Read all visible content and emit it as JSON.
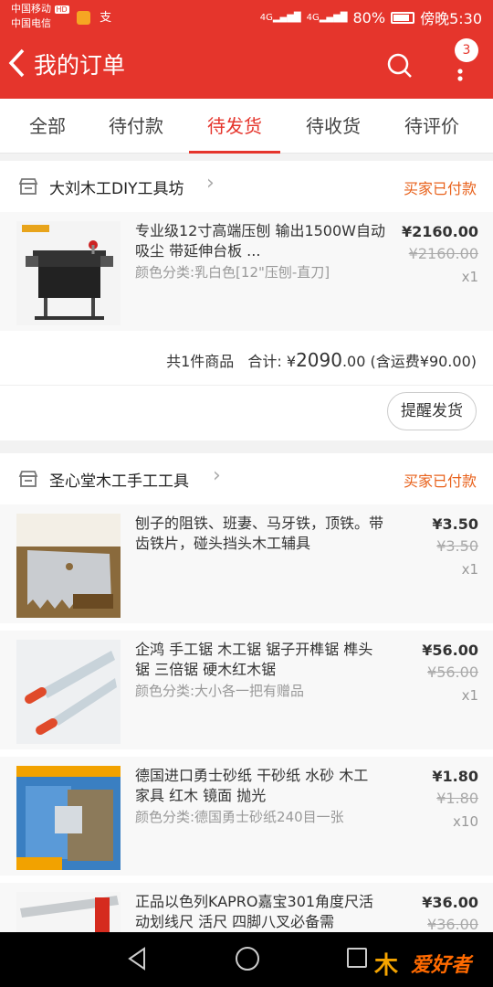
{
  "status_bar": {
    "carrier1": "中国移动",
    "carrier2": "中国电信",
    "hd": "HD",
    "net1": "4G",
    "net2": "4G",
    "battery": "80%",
    "time": "傍晚5:30"
  },
  "header": {
    "title": "我的订单",
    "badge": "3"
  },
  "tabs": [
    "全部",
    "待付款",
    "待发货",
    "待收货",
    "待评价"
  ],
  "active_tab": "待发货",
  "orders": [
    {
      "shop": "大刘木工DIY工具坊",
      "status": "买家已付款",
      "items": [
        {
          "name": "专业级12寸高端压刨 输出1500W自动吸尘 带延伸台板 ...",
          "sku": "颜色分类:乳白色[12\"压刨-直刀]",
          "price": "¥2160.00",
          "original_price": "¥2160.00",
          "qty": "x1"
        }
      ],
      "summary": {
        "count": "共1件商品",
        "total_label": "合计:",
        "currency": "¥",
        "total_int": "2090",
        "total_dec": ".00",
        "shipping": "(含运费¥90.00)"
      },
      "action": "提醒发货"
    },
    {
      "shop": "圣心堂木工手工工具",
      "status": "买家已付款",
      "items": [
        {
          "name": "刨子的阻铁、班妻、马牙铁，顶铁。带齿铁片，碰头挡头木工辅具",
          "sku": "",
          "price": "¥3.50",
          "original_price": "¥3.50",
          "qty": "x1"
        },
        {
          "name": "企鸿 手工锯 木工锯 锯子开榫锯 榫头锯 三倍锯 硬木红木锯",
          "sku": "颜色分类:大小各一把有赠品",
          "price": "¥56.00",
          "original_price": "¥56.00",
          "qty": "x1"
        },
        {
          "name": "德国进口勇士砂纸 干砂纸 水砂 木工 家具 红木 镜面 抛光",
          "sku": "颜色分类:德国勇士砂纸240目一张",
          "price": "¥1.80",
          "original_price": "¥1.80",
          "qty": "x10"
        },
        {
          "name": "正品以色列KAPRO嘉宝301角度尺活动划线尺 活尺 四脚八叉必备需",
          "sku": "",
          "price": "¥36.00",
          "original_price": "¥36.00",
          "qty": ""
        }
      ]
    }
  ],
  "watermark": "爱好者",
  "colors": {
    "brand": "#e5352c",
    "status_orange": "#e8621c"
  }
}
